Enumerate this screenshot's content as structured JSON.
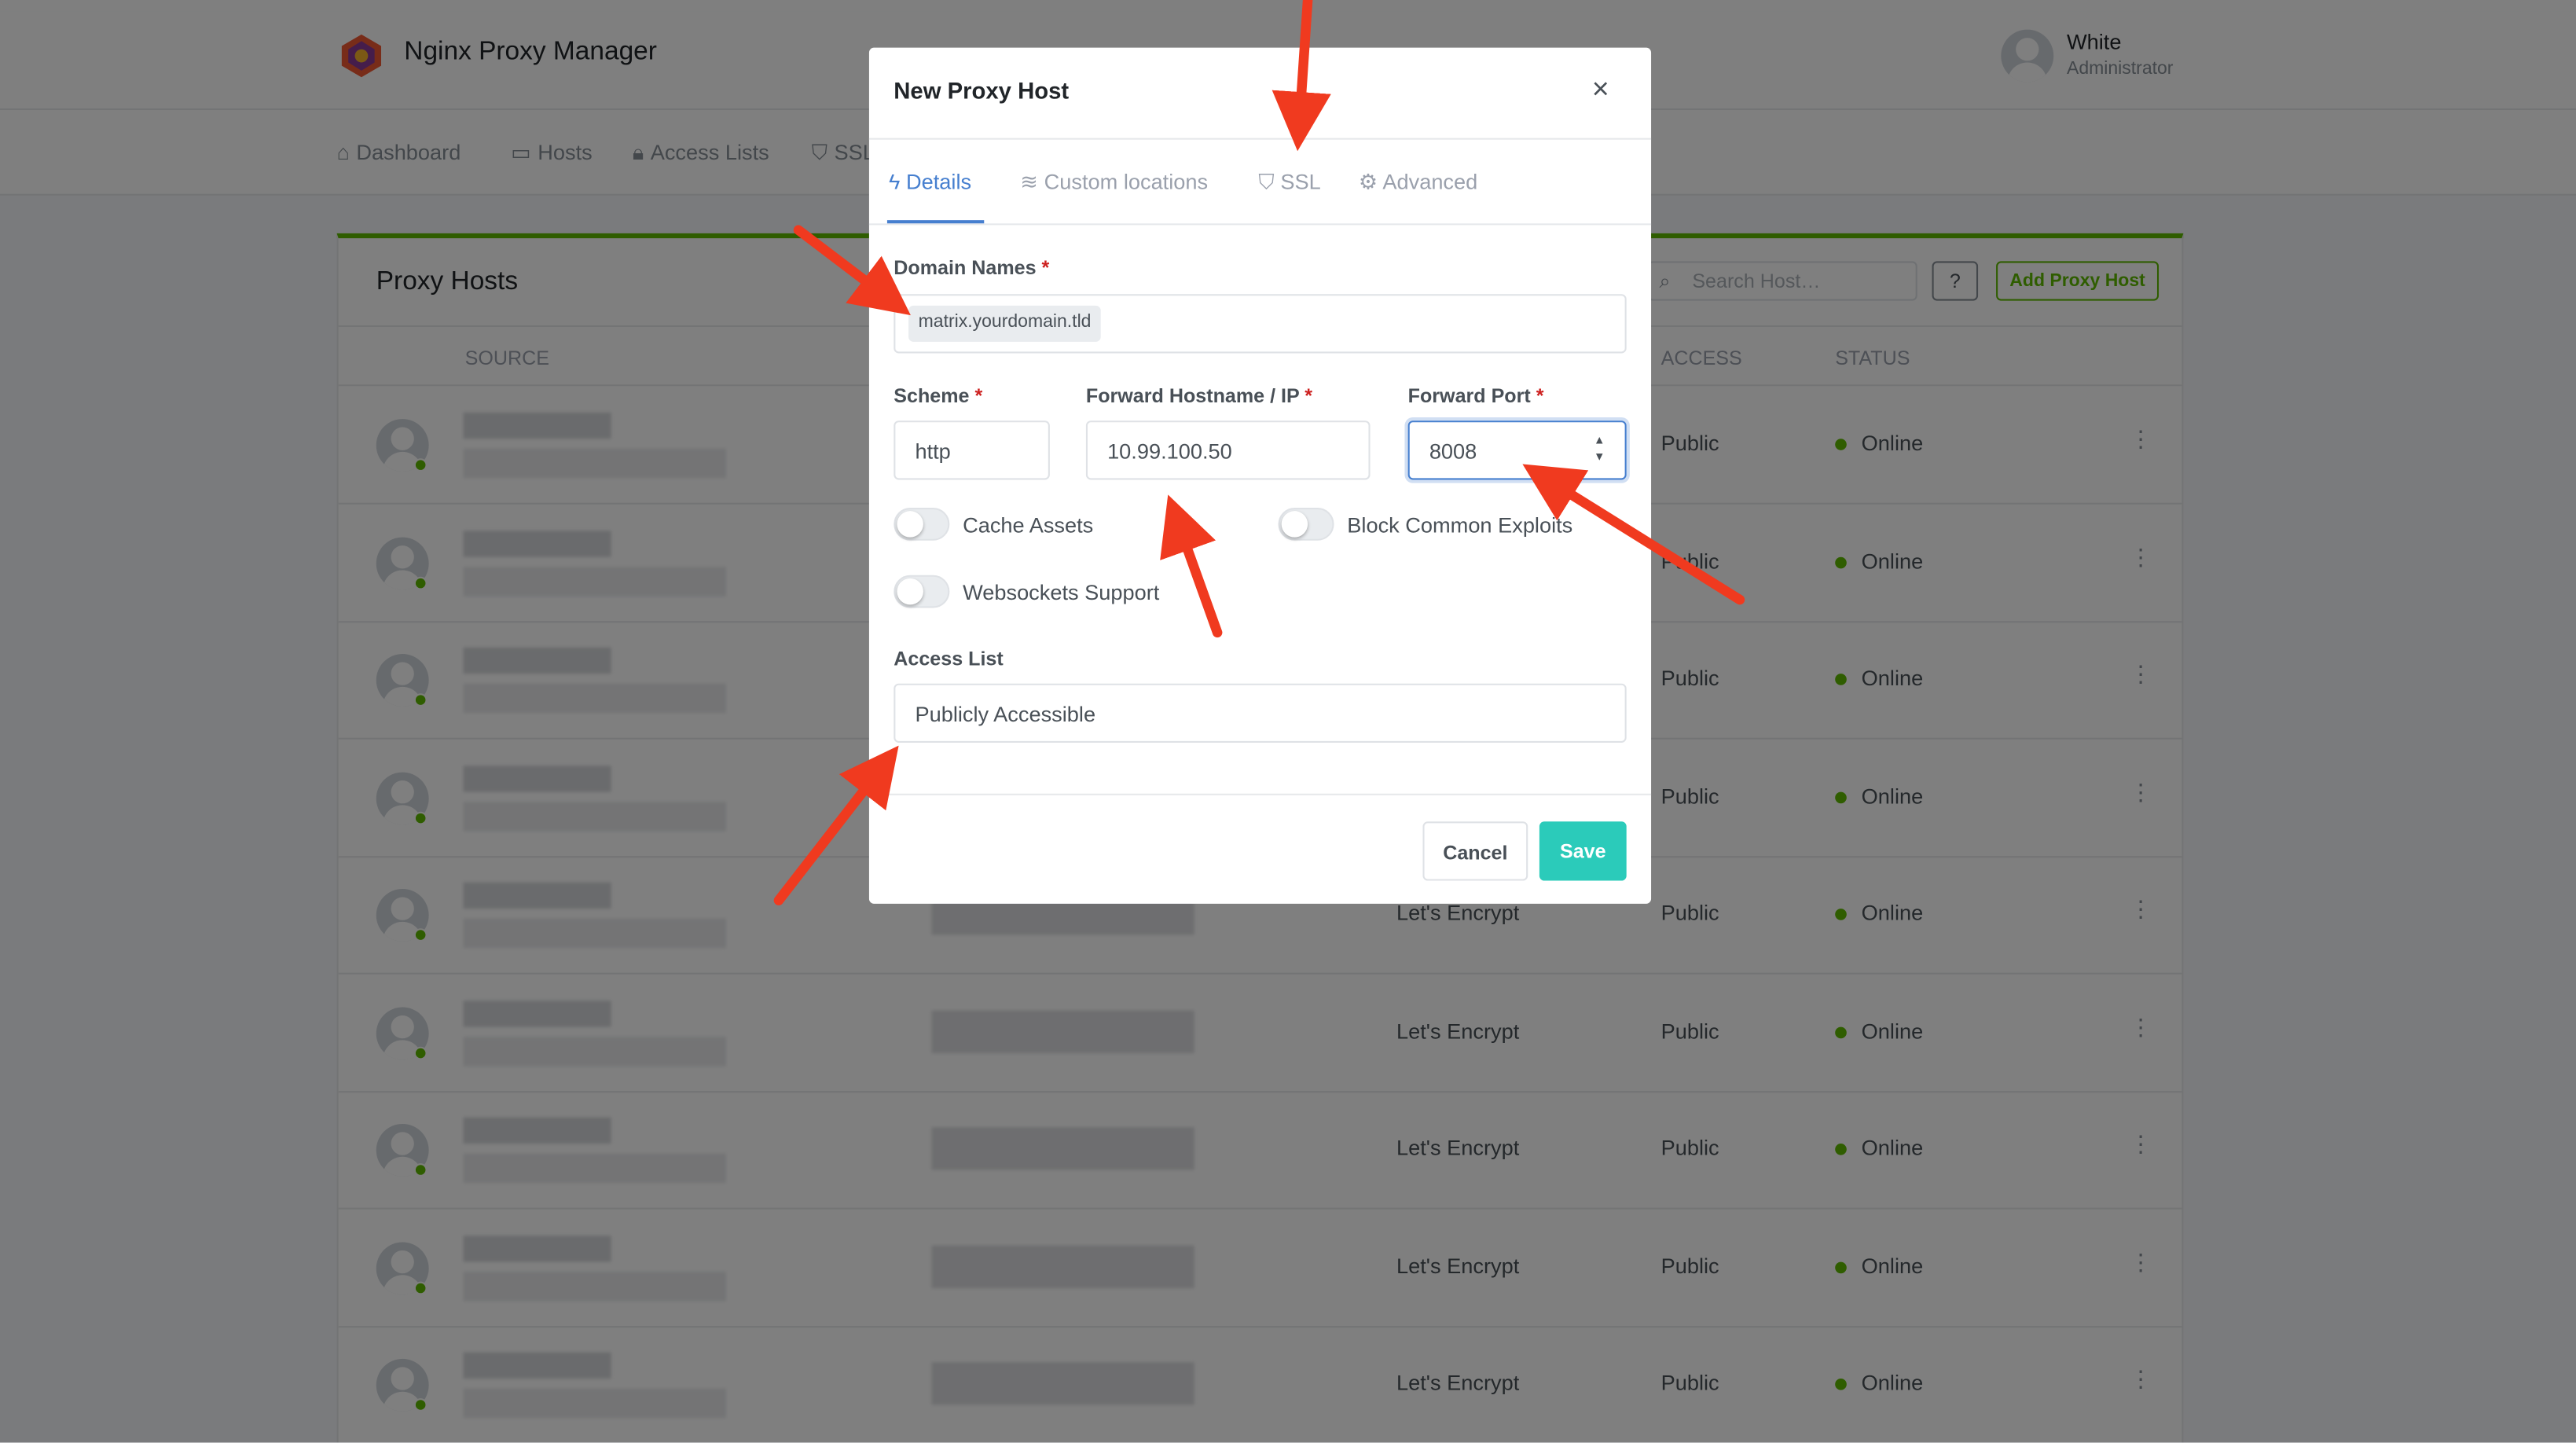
{
  "app": {
    "title": "Nginx Proxy Manager"
  },
  "user": {
    "name": "White",
    "role": "Administrator"
  },
  "nav": [
    {
      "label": "Dashboard",
      "icon": "home-icon"
    },
    {
      "label": "Hosts",
      "icon": "monitor-icon"
    },
    {
      "label": "Access Lists",
      "icon": "lock-icon"
    },
    {
      "label": "SSL",
      "icon": "shield-icon"
    }
  ],
  "card": {
    "title": "Proxy Hosts",
    "search_placeholder": "Search Host…",
    "help_label": "?",
    "add_label": "Add Proxy Host"
  },
  "table": {
    "headers": {
      "source": "SOURCE",
      "access": "ACCESS",
      "status": "STATUS"
    },
    "rows": [
      {
        "ssl": "",
        "access": "Public",
        "status": "Online"
      },
      {
        "ssl": "",
        "access": "Public",
        "status": "Online"
      },
      {
        "ssl": "",
        "access": "Public",
        "status": "Online"
      },
      {
        "ssl": "",
        "access": "Public",
        "status": "Online"
      },
      {
        "ssl": "Let's Encrypt",
        "access": "Public",
        "status": "Online"
      },
      {
        "ssl": "Let's Encrypt",
        "access": "Public",
        "status": "Online"
      },
      {
        "ssl": "Let's Encrypt",
        "access": "Public",
        "status": "Online"
      },
      {
        "ssl": "Let's Encrypt",
        "access": "Public",
        "status": "Online"
      },
      {
        "ssl": "Let's Encrypt",
        "access": "Public",
        "status": "Online"
      }
    ]
  },
  "modal": {
    "title": "New Proxy Host",
    "close": "×",
    "tabs": [
      {
        "label": "Details",
        "icon": "bolt-icon",
        "active": true
      },
      {
        "label": "Custom locations",
        "icon": "layers-icon",
        "active": false
      },
      {
        "label": "SSL",
        "icon": "shield-icon",
        "active": false
      },
      {
        "label": "Advanced",
        "icon": "gear-icon",
        "active": false
      }
    ],
    "domain_names_label": "Domain Names",
    "domain_names_value": "matrix.yourdomain.tld",
    "scheme_label": "Scheme",
    "scheme_value": "http",
    "forward_host_label": "Forward Hostname / IP",
    "forward_host_value": "10.99.100.50",
    "forward_port_label": "Forward Port",
    "forward_port_value": "8008",
    "required_mark": "*",
    "toggles": {
      "cache_assets": "Cache Assets",
      "block_exploits": "Block Common Exploits",
      "websockets": "Websockets Support"
    },
    "access_list_label": "Access List",
    "access_list_value": "Publicly Accessible",
    "cancel_label": "Cancel",
    "save_label": "Save"
  },
  "colors": {
    "accent": "#467fcf",
    "success": "#5eba00",
    "save": "#2bcbba",
    "arrow": "#f03a1f"
  }
}
